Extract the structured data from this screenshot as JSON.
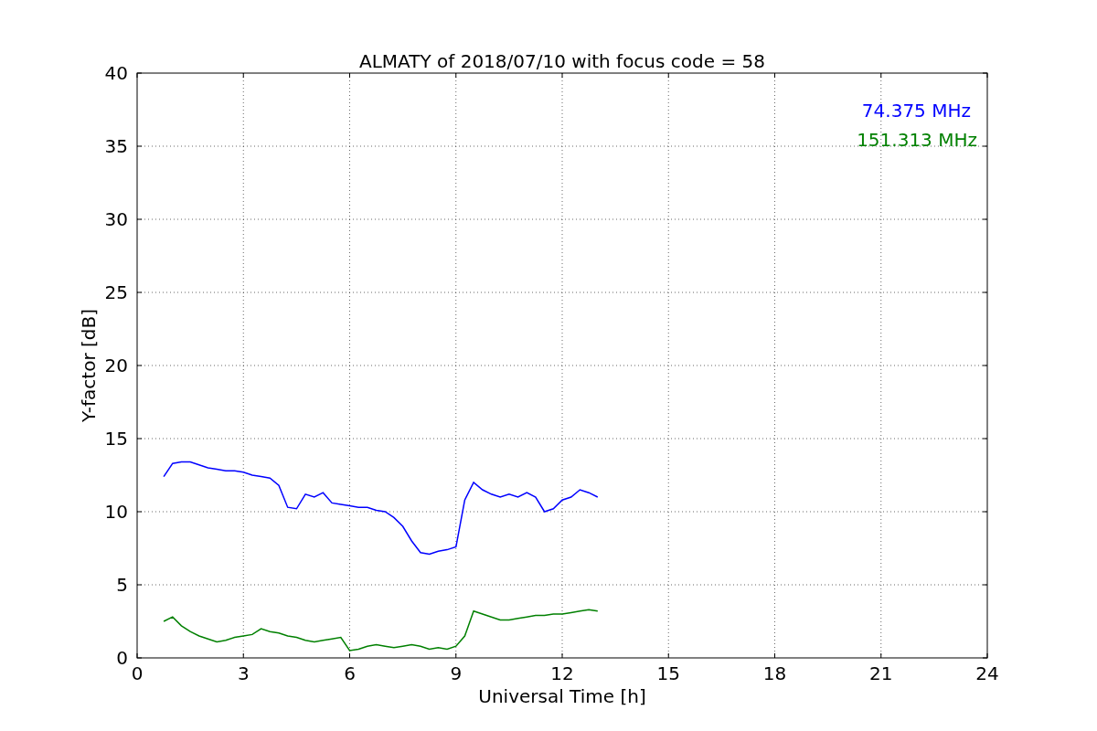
{
  "chart_data": {
    "type": "line",
    "title": "ALMATY of 2018/07/10 with focus code = 58",
    "xlabel": "Universal Time [h]",
    "ylabel": "Y-factor [dB]",
    "x": [
      0.75,
      1.0,
      1.25,
      1.5,
      1.75,
      2.0,
      2.25,
      2.5,
      2.75,
      3.0,
      3.25,
      3.5,
      3.75,
      4.0,
      4.25,
      4.5,
      4.75,
      5.0,
      5.25,
      5.5,
      5.75,
      6.0,
      6.25,
      6.5,
      6.75,
      7.0,
      7.25,
      7.5,
      7.75,
      8.0,
      8.25,
      8.5,
      8.75,
      9.0,
      9.25,
      9.5,
      9.75,
      10.0,
      10.25,
      10.5,
      10.75,
      11.0,
      11.25,
      11.5,
      11.75,
      12.0,
      12.25,
      12.5,
      12.75,
      13.0
    ],
    "series": [
      {
        "name": "74.375 MHz",
        "color": "#0000ff",
        "values": [
          12.4,
          13.3,
          13.4,
          13.4,
          13.2,
          13.0,
          12.9,
          12.8,
          12.8,
          12.7,
          12.5,
          12.4,
          12.3,
          11.8,
          10.3,
          10.2,
          11.2,
          11.0,
          11.3,
          10.6,
          10.5,
          10.4,
          10.3,
          10.3,
          10.1,
          10.0,
          9.6,
          9.0,
          8.0,
          7.2,
          7.1,
          7.3,
          7.4,
          7.6,
          10.8,
          12.0,
          11.5,
          11.2,
          11.0,
          11.2,
          11.0,
          11.3,
          11.0,
          10.0,
          10.2,
          10.8,
          11.0,
          11.5,
          11.3,
          11.0
        ]
      },
      {
        "name": "151.313 MHz",
        "color": "#008000",
        "values": [
          2.5,
          2.8,
          2.2,
          1.8,
          1.5,
          1.3,
          1.1,
          1.2,
          1.4,
          1.5,
          1.6,
          2.0,
          1.8,
          1.7,
          1.5,
          1.4,
          1.2,
          1.1,
          1.2,
          1.3,
          1.4,
          0.5,
          0.6,
          0.8,
          0.9,
          0.8,
          0.7,
          0.8,
          0.9,
          0.8,
          0.6,
          0.7,
          0.6,
          0.8,
          1.5,
          3.2,
          3.0,
          2.8,
          2.6,
          2.6,
          2.7,
          2.8,
          2.9,
          2.9,
          3.0,
          3.0,
          3.1,
          3.2,
          3.3,
          3.2
        ]
      }
    ],
    "grid": true,
    "xlim": [
      0,
      24
    ],
    "ylim": [
      0,
      40
    ],
    "xticks": [
      0,
      3,
      6,
      9,
      12,
      15,
      18,
      21,
      24
    ],
    "yticks": [
      0,
      5,
      10,
      15,
      20,
      25,
      30,
      35,
      40
    ]
  }
}
